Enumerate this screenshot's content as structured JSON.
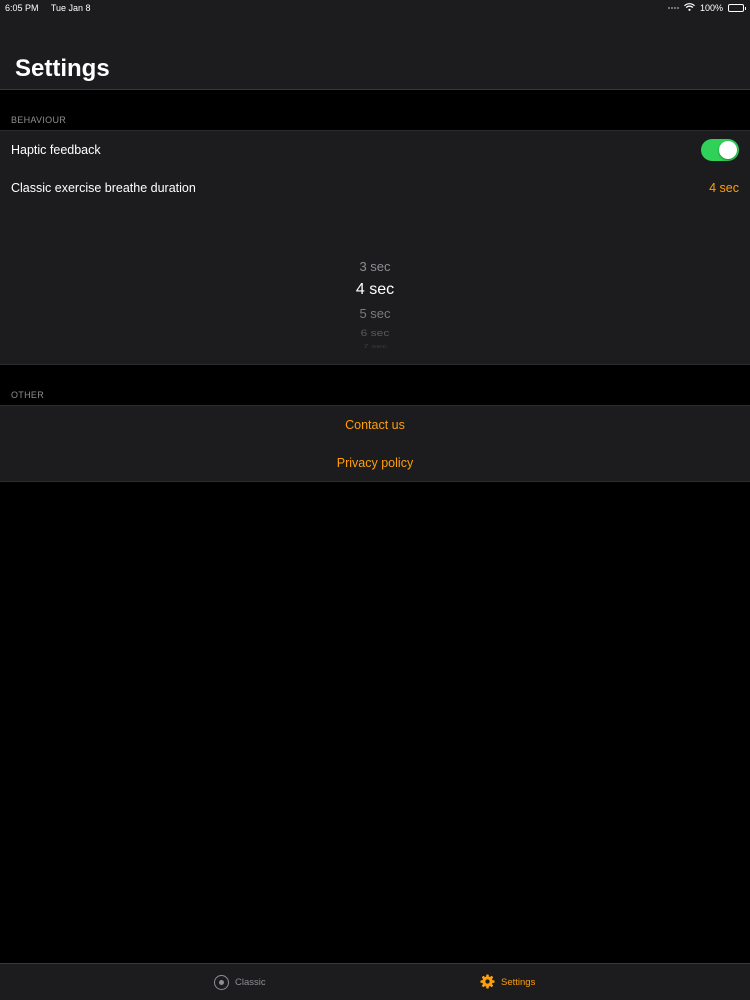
{
  "status_bar": {
    "time": "6:05 PM",
    "date": "Tue Jan 8",
    "battery": "100%",
    "icons": [
      "signal-dots-icon",
      "wifi-icon",
      "battery-icon"
    ]
  },
  "header": {
    "title": "Settings"
  },
  "sections": {
    "behaviour": {
      "header": "BEHAVIOUR",
      "haptic": {
        "label": "Haptic feedback",
        "enabled": true
      },
      "breathe": {
        "label": "Classic exercise breathe duration",
        "value": "4 sec"
      },
      "picker": {
        "options": [
          "3 sec",
          "4 sec",
          "5 sec",
          "6 sec",
          "7 sec"
        ],
        "selected": "4 sec"
      }
    },
    "other": {
      "header": "OTHER",
      "contact": "Contact us",
      "privacy": "Privacy policy"
    }
  },
  "tab_bar": {
    "tabs": [
      {
        "label": "Classic",
        "icon": "target-icon",
        "active": false
      },
      {
        "label": "Settings",
        "icon": "gear-icon",
        "active": true
      }
    ]
  },
  "colors": {
    "accent": "#ff9f0a",
    "toggle_on": "#30d158",
    "background": "#000000",
    "cell": "#1c1c1e"
  }
}
